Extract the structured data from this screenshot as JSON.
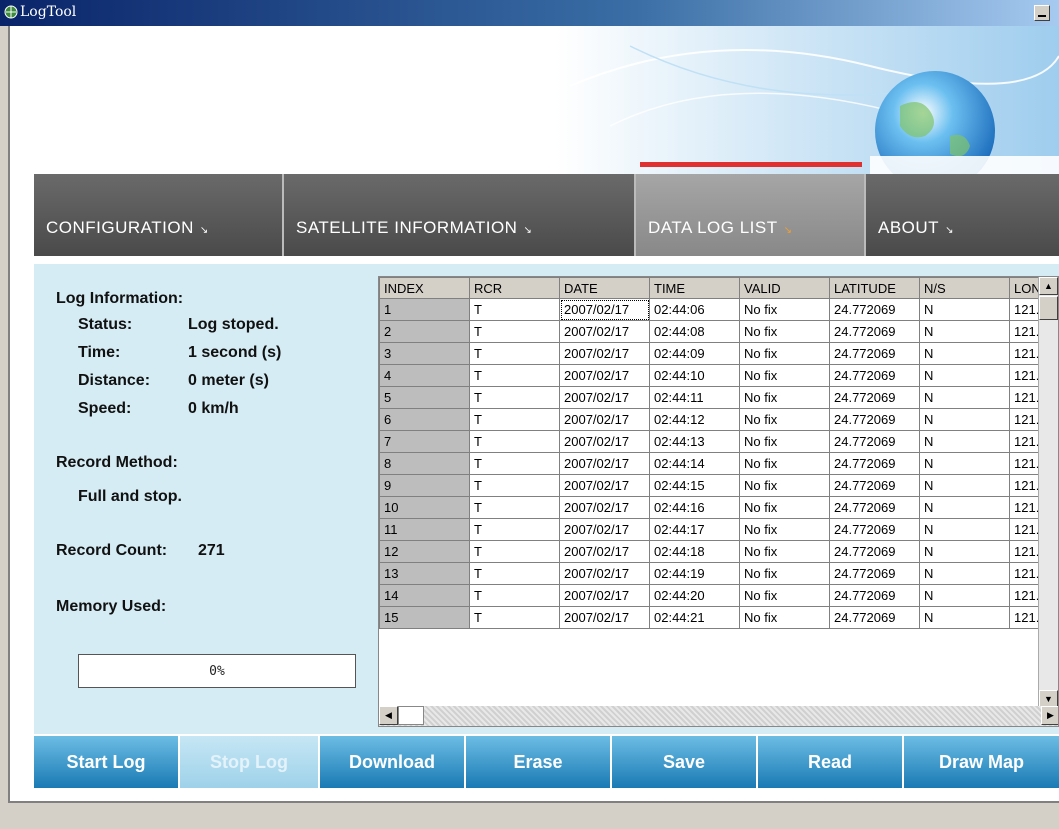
{
  "window": {
    "title": "LogTool"
  },
  "nav": {
    "tabs": [
      {
        "label": "CONFIGURATION",
        "arrow": "↘",
        "active": false
      },
      {
        "label": "SATELLITE  INFORMATION",
        "arrow": "↘",
        "active": false
      },
      {
        "label": "DATA  LOG  LIST",
        "arrow": "↘",
        "active": true
      },
      {
        "label": "ABOUT",
        "arrow": "↘",
        "active": false
      }
    ]
  },
  "log_info": {
    "heading": "Log Information:",
    "status_label": "Status:",
    "status_value": "Log stoped.",
    "time_label": "Time:",
    "time_value": "1 second (s)",
    "distance_label": "Distance:",
    "distance_value": "0 meter (s)",
    "speed_label": "Speed:",
    "speed_value": "0 km/h",
    "record_method_label": "Record Method:",
    "record_method_value": "Full and stop.",
    "record_count_label": "Record Count:",
    "record_count_value": "271",
    "memory_used_label": "Memory Used:",
    "memory_used_value": "0%"
  },
  "table": {
    "columns": [
      "INDEX",
      "RCR",
      "DATE",
      "TIME",
      "VALID",
      "LATITUDE",
      "N/S",
      "LON"
    ],
    "rows": [
      [
        "1",
        "T",
        "2007/02/17",
        "02:44:06",
        "No fix",
        "24.772069",
        "N",
        "121."
      ],
      [
        "2",
        "T",
        "2007/02/17",
        "02:44:08",
        "No fix",
        "24.772069",
        "N",
        "121."
      ],
      [
        "3",
        "T",
        "2007/02/17",
        "02:44:09",
        "No fix",
        "24.772069",
        "N",
        "121."
      ],
      [
        "4",
        "T",
        "2007/02/17",
        "02:44:10",
        "No fix",
        "24.772069",
        "N",
        "121."
      ],
      [
        "5",
        "T",
        "2007/02/17",
        "02:44:11",
        "No fix",
        "24.772069",
        "N",
        "121."
      ],
      [
        "6",
        "T",
        "2007/02/17",
        "02:44:12",
        "No fix",
        "24.772069",
        "N",
        "121."
      ],
      [
        "7",
        "T",
        "2007/02/17",
        "02:44:13",
        "No fix",
        "24.772069",
        "N",
        "121."
      ],
      [
        "8",
        "T",
        "2007/02/17",
        "02:44:14",
        "No fix",
        "24.772069",
        "N",
        "121."
      ],
      [
        "9",
        "T",
        "2007/02/17",
        "02:44:15",
        "No fix",
        "24.772069",
        "N",
        "121."
      ],
      [
        "10",
        "T",
        "2007/02/17",
        "02:44:16",
        "No fix",
        "24.772069",
        "N",
        "121."
      ],
      [
        "11",
        "T",
        "2007/02/17",
        "02:44:17",
        "No fix",
        "24.772069",
        "N",
        "121."
      ],
      [
        "12",
        "T",
        "2007/02/17",
        "02:44:18",
        "No fix",
        "24.772069",
        "N",
        "121."
      ],
      [
        "13",
        "T",
        "2007/02/17",
        "02:44:19",
        "No fix",
        "24.772069",
        "N",
        "121."
      ],
      [
        "14",
        "T",
        "2007/02/17",
        "02:44:20",
        "No fix",
        "24.772069",
        "N",
        "121."
      ],
      [
        "15",
        "T",
        "2007/02/17",
        "02:44:21",
        "No fix",
        "24.772069",
        "N",
        "121."
      ]
    ]
  },
  "actions": [
    {
      "label": "Start Log",
      "enabled": true
    },
    {
      "label": "Stop Log",
      "enabled": false
    },
    {
      "label": "Download",
      "enabled": true
    },
    {
      "label": "Erase",
      "enabled": true
    },
    {
      "label": "Save",
      "enabled": true
    },
    {
      "label": "Read",
      "enabled": true
    },
    {
      "label": "Draw Map",
      "enabled": true
    }
  ],
  "icons": {
    "app": "globe-icon",
    "minimize": "minimize-icon",
    "scroll_up": "arrow-up-icon",
    "scroll_down": "arrow-down-icon",
    "scroll_left": "arrow-left-icon",
    "scroll_right": "arrow-right-icon"
  },
  "colors": {
    "accent": "#e03030",
    "button": "#2a8bc4",
    "panel": "#d5ecf4",
    "nav": "#5e5e5e",
    "nav_active_arrow": "#f0a030"
  }
}
